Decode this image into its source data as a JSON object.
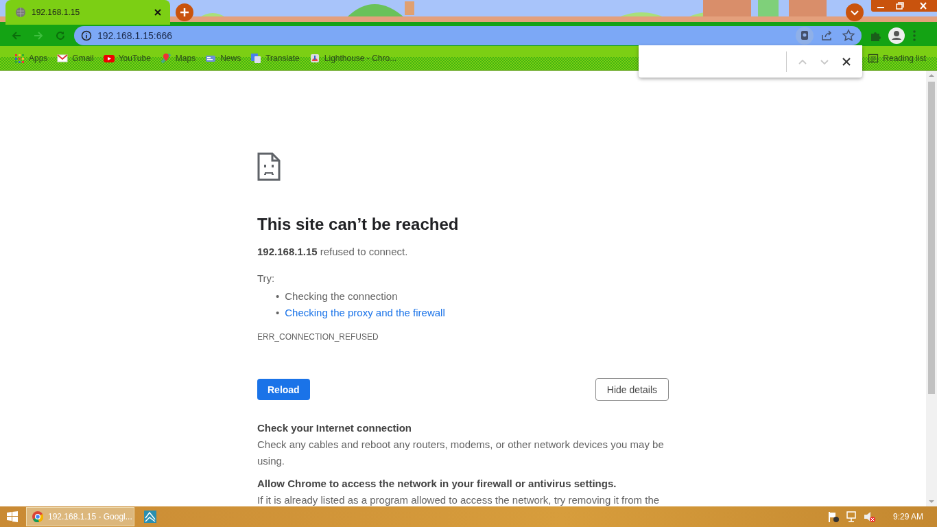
{
  "tabs": [
    {
      "title": "192.168.1.15",
      "selected": true
    }
  ],
  "toolbar": {
    "back_disabled": false,
    "forward_disabled": true
  },
  "address_bar": {
    "url": "192.168.1.15:666"
  },
  "bookmarks": [
    {
      "kind": "apps",
      "label": "Apps"
    },
    {
      "kind": "mail",
      "label": "Gmail"
    },
    {
      "kind": "video",
      "label": "YouTube"
    },
    {
      "kind": "map",
      "label": "Maps"
    },
    {
      "kind": "news",
      "label": "News"
    },
    {
      "kind": "translate",
      "label": "Translate"
    },
    {
      "kind": "lighthouse",
      "label": "Lighthouse - Chro..."
    }
  ],
  "reading_list": "Reading list",
  "find_bar": {
    "previous_disabled": true,
    "next_disabled": true
  },
  "error_page": {
    "title": "This site can’t be reached",
    "message": "**192.168.1.15** refused to connect.",
    "try_label": "Try:",
    "suggestions": [
      {
        "kind": "plain",
        "marker": "•",
        "text": "Checking the connection"
      },
      {
        "kind": "link",
        "marker": "•",
        "text": "Checking the proxy and the firewall"
      }
    ],
    "error_code": "ERR_CONNECTION_REFUSED",
    "reload_button": "Reload",
    "details_button": "Hide details",
    "details": [
      {
        "heading": "Check your Internet connection",
        "body": "Check any cables and reboot any routers, modems, or other network devices you may be using."
      },
      {
        "heading": "Allow Chrome to access the network in your firewall or antivirus settings.",
        "body": "If it is already listed as a program allowed to access the network, try removing it from the"
      }
    ]
  },
  "taskbar": {
    "windows": [
      {
        "kind": "browser",
        "label": "192.168.1.15 - Googl...",
        "selected": true
      },
      {
        "kind": "app",
        "selected": false
      }
    ],
    "clock": "9:29 AM"
  }
}
